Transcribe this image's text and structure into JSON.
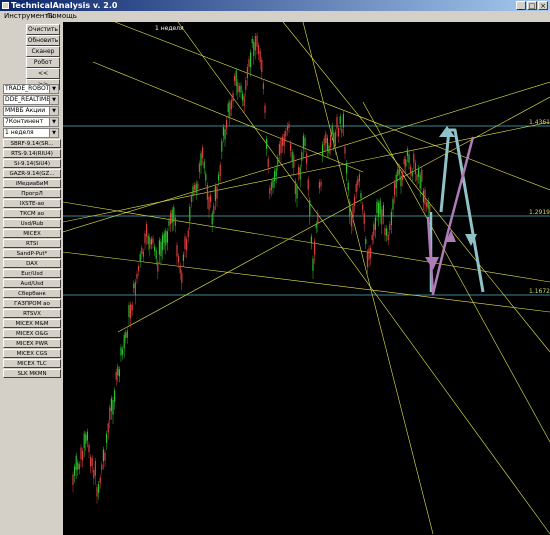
{
  "window": {
    "title": "TechnicalAnalysis v. 2.0",
    "controls": [
      "_",
      "□",
      "×"
    ]
  },
  "menu": [
    "Инструменты",
    "Помощь"
  ],
  "toolbar": {
    "clear": "Очистить",
    "refresh": "Обновить",
    "scanner": "Сканер",
    "robot": "Робот",
    "prev": "<<",
    "next": ">>"
  },
  "selectors": [
    "TRADE_ROBOT",
    "DDE_REALTIME",
    "ММВБ Акции",
    "7Континент",
    "1 неделя"
  ],
  "instruments": [
    "SBRF-9.14(SR...",
    "RTS-9.14(RIU4)",
    "Si-9.14(SiU4)",
    "GAZR-9.14(GZ...",
    "iМедиаБиМ",
    "ПрогрЛ",
    "IXSTE-ао",
    "ТКСМ ао",
    "Usd/Rub",
    "MICEX",
    "RTSI",
    "SandP-Put*",
    "DAX",
    "Eur/Usd",
    "Aud/Usd",
    "Сбербанк",
    "ГАЗПРОМ ао",
    "RTSVX",
    "MICEX M&M",
    "MICEX O&G",
    "MICEX PWR",
    "MICEX CGS",
    "MICEX TLC",
    "SLK MKMN"
  ],
  "chart": {
    "period_label": "1 неделя",
    "price_levels": [
      "1.4361",
      "1.2919",
      "1.1672"
    ],
    "colors": {
      "background": "#000000",
      "level_line": "#4fb6c6",
      "trend_line": "#e6e64c",
      "up_candle": "#2ec42e",
      "down_candle": "#e04040",
      "forecast_blue": "#8fc3c8",
      "forecast_purple": "#b07cb8",
      "level_text": "#d8d870"
    }
  }
}
